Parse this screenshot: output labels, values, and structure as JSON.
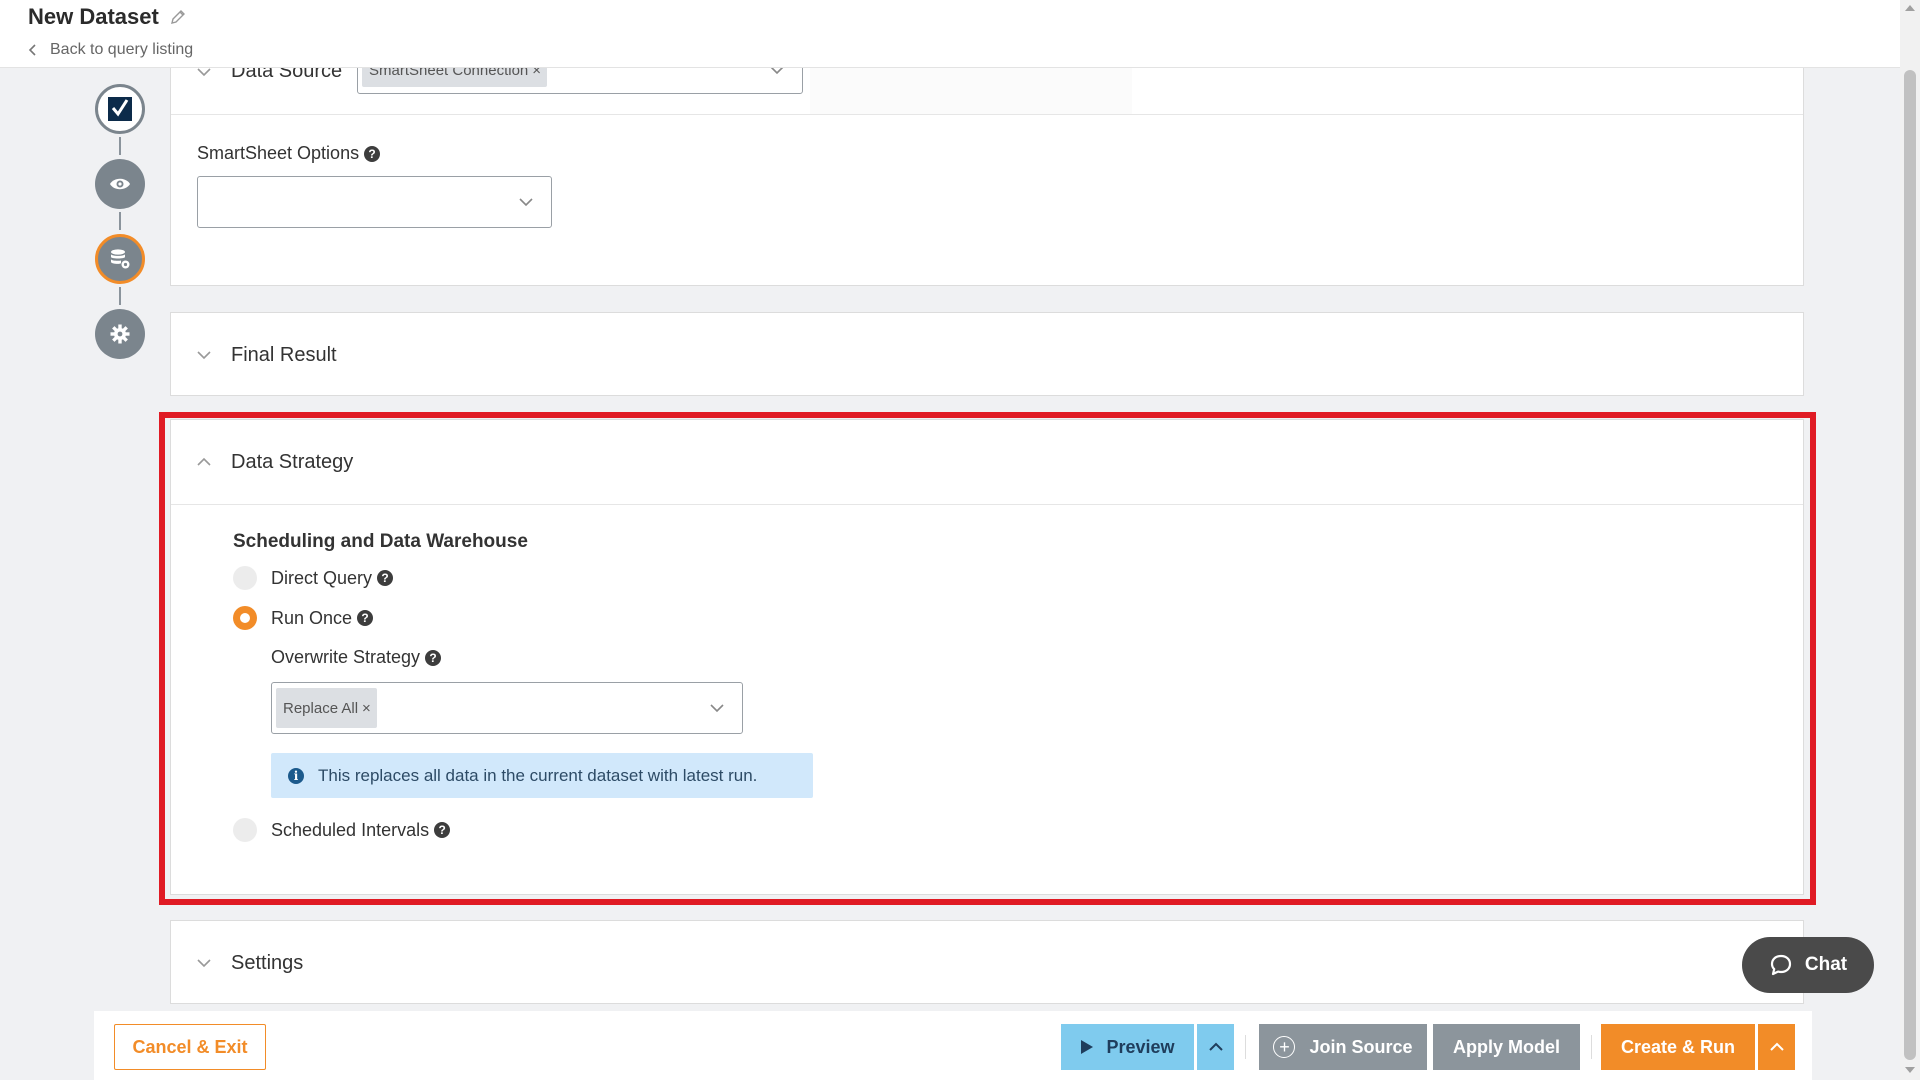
{
  "header": {
    "title": "New Dataset",
    "back_link": "Back to query listing"
  },
  "stepper": {
    "steps": [
      {
        "icon": "smartsheet-logo-icon",
        "state": "done"
      },
      {
        "icon": "eye-icon",
        "state": "done"
      },
      {
        "icon": "database-gear-icon",
        "state": "active"
      },
      {
        "icon": "gear-icon",
        "state": "pending"
      }
    ]
  },
  "data_source_panel": {
    "label": "Data Source",
    "selected_tag": "SmartSheet Connection",
    "options_label": "SmartSheet Options",
    "options_value": ""
  },
  "final_result_panel": {
    "title": "Final Result"
  },
  "data_strategy_panel": {
    "title": "Data Strategy",
    "section_title": "Scheduling and Data Warehouse",
    "options": [
      {
        "label": "Direct Query",
        "checked": false
      },
      {
        "label": "Run Once",
        "checked": true
      },
      {
        "label": "Scheduled Intervals",
        "checked": false
      }
    ],
    "overwrite_label": "Overwrite Strategy",
    "overwrite_tag": "Replace All",
    "info_text": "This replaces all data in the current dataset with latest run."
  },
  "settings_panel": {
    "title": "Settings"
  },
  "chat": {
    "label": "Chat"
  },
  "footer": {
    "cancel_label": "Cancel & Exit",
    "preview_label": "Preview",
    "join_label": "Join Source",
    "apply_label": "Apply Model",
    "create_label": "Create & Run"
  },
  "colors": {
    "accent": "#f28c28",
    "preview": "#7fcbee",
    "neutral_button": "#8c959c",
    "highlight": "#e01b24",
    "info_bg": "#d1e8fb"
  }
}
